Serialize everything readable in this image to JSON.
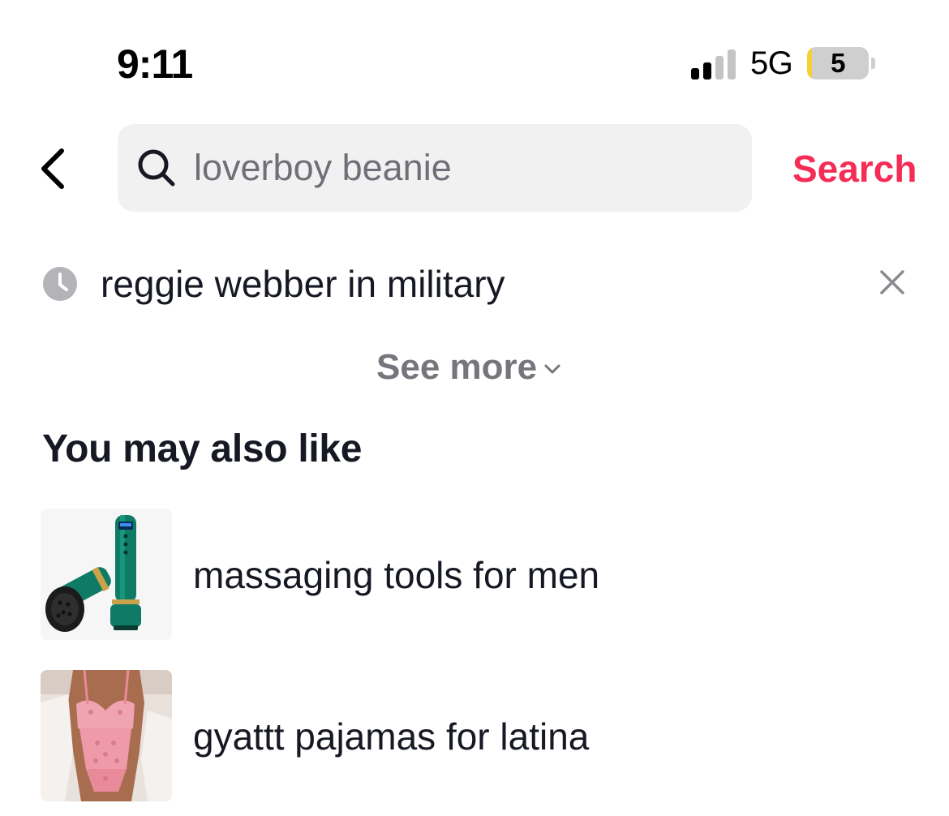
{
  "status_bar": {
    "time": "9:11",
    "network": "5G",
    "battery_level": "5",
    "signal_bars_active": 2,
    "signal_bars_total": 4
  },
  "search": {
    "back_icon": "chevron-left-icon",
    "search_icon": "magnifier-icon",
    "query": "loverboy beanie",
    "button_label": "Search",
    "accent_color": "#f52c55"
  },
  "history": {
    "items": [
      {
        "text": "reggie webber in military",
        "icon": "clock-icon",
        "remove_icon": "close-icon"
      }
    ],
    "see_more_label": "See more"
  },
  "suggestions": {
    "title": "You may also like",
    "items": [
      {
        "label": "massaging tools for men",
        "thumbnail": "green-massager-device"
      },
      {
        "label": "gyattt pajamas for latina",
        "thumbnail": "pink-lace-lingerie"
      }
    ]
  }
}
